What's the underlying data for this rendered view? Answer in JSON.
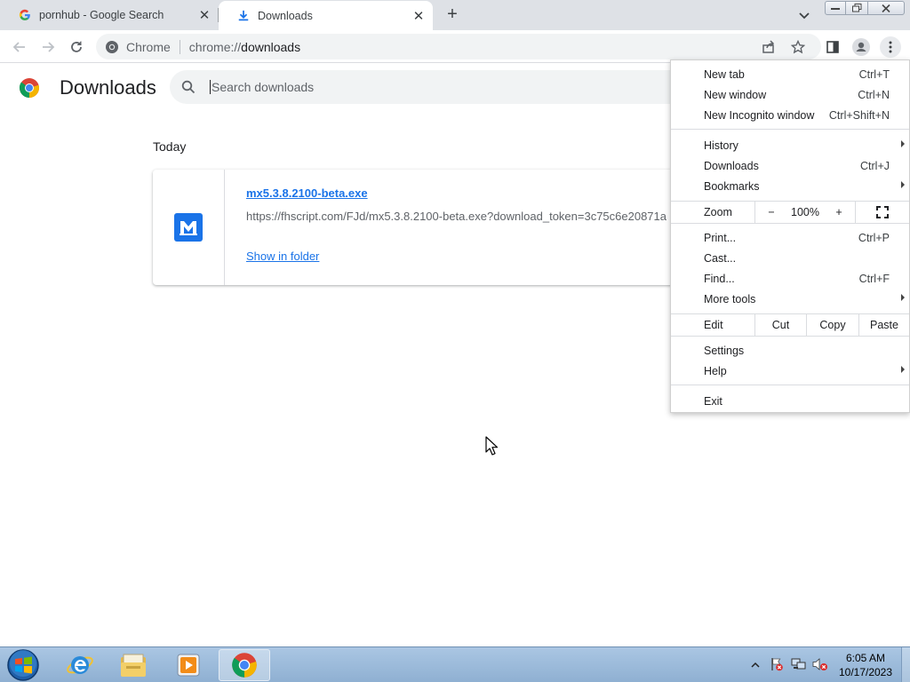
{
  "browser": {
    "tabs": [
      {
        "title": "pornhub - Google Search",
        "icon": "google-icon",
        "active": false
      },
      {
        "title": "Downloads",
        "icon": "download-icon",
        "active": true
      }
    ],
    "new_tab_symbol": "+",
    "tab_search_icon": "chevron-down-icon",
    "window_controls": {
      "min": "▭",
      "max": "⧉",
      "close": "✕"
    }
  },
  "toolbar": {
    "omnibox_chip": "Chrome",
    "url_scheme": "chrome://",
    "url_host": "downloads"
  },
  "downloads_page": {
    "title": "Downloads",
    "search_placeholder": "Search downloads",
    "section_label": "Today",
    "items": [
      {
        "file_name": "mx5.3.8.2100-beta.exe",
        "url": "https://fhscript.com/FJd/mx5.3.8.2100-beta.exe?download_token=3c75c6e20871a",
        "action": "Show in folder",
        "icon": "maxthon-icon"
      }
    ]
  },
  "app_menu": {
    "new_tab": {
      "label": "New tab",
      "shortcut": "Ctrl+T"
    },
    "new_window": {
      "label": "New window",
      "shortcut": "Ctrl+N"
    },
    "new_incognito": {
      "label": "New Incognito window",
      "shortcut": "Ctrl+Shift+N"
    },
    "history": {
      "label": "History"
    },
    "downloads": {
      "label": "Downloads",
      "shortcut": "Ctrl+J"
    },
    "bookmarks": {
      "label": "Bookmarks"
    },
    "zoom": {
      "label": "Zoom",
      "minus": "−",
      "value": "100%",
      "plus": "+"
    },
    "print": {
      "label": "Print...",
      "shortcut": "Ctrl+P"
    },
    "cast": {
      "label": "Cast..."
    },
    "find": {
      "label": "Find...",
      "shortcut": "Ctrl+F"
    },
    "more_tools": {
      "label": "More tools"
    },
    "edit": {
      "label": "Edit",
      "cut": "Cut",
      "copy": "Copy",
      "paste": "Paste"
    },
    "settings": {
      "label": "Settings"
    },
    "help": {
      "label": "Help"
    },
    "exit": {
      "label": "Exit"
    }
  },
  "taskbar": {
    "time": "6:05 AM",
    "date": "10/17/2023",
    "apps": [
      "internet-explorer-icon",
      "file-explorer-icon",
      "media-player-icon",
      "chrome-icon"
    ]
  },
  "colors": {
    "accent": "#1a73e8",
    "tab_strip": "#dee1e6",
    "omnibox": "#f1f3f4"
  }
}
